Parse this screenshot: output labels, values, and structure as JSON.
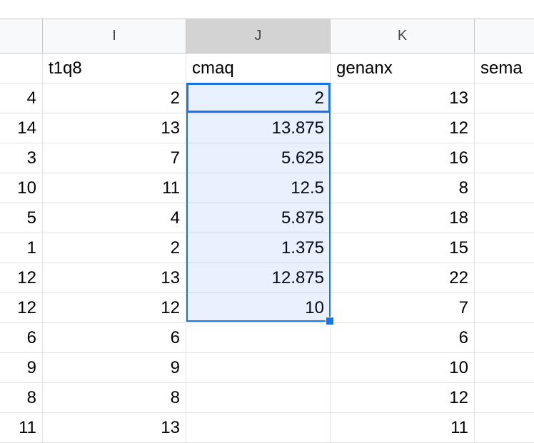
{
  "columns": [
    {
      "letter": "I"
    },
    {
      "letter": "J",
      "selected": true
    },
    {
      "letter": "K"
    },
    {
      "letter": ""
    }
  ],
  "header_labels": [
    "",
    "t1q8",
    "cmaq",
    "genanx",
    "sema"
  ],
  "rows": [
    [
      "4",
      "2",
      "2",
      "13",
      ""
    ],
    [
      "14",
      "13",
      "13.875",
      "12",
      ""
    ],
    [
      "3",
      "7",
      "5.625",
      "16",
      ""
    ],
    [
      "10",
      "11",
      "12.5",
      "8",
      ""
    ],
    [
      "5",
      "4",
      "5.875",
      "18",
      ""
    ],
    [
      "1",
      "2",
      "1.375",
      "15",
      ""
    ],
    [
      "12",
      "13",
      "12.875",
      "22",
      ""
    ],
    [
      "12",
      "12",
      "10",
      "7",
      ""
    ],
    [
      "6",
      "6",
      "",
      "6",
      ""
    ],
    [
      "9",
      "9",
      "",
      "10",
      ""
    ],
    [
      "8",
      "8",
      "",
      "12",
      ""
    ],
    [
      "11",
      "13",
      "",
      "11",
      ""
    ]
  ],
  "selection": {
    "column": "J",
    "active_cell_value": "2"
  },
  "colors": {
    "selection_border": "#1a73e8",
    "header_bg": "#f8f9fa",
    "selected_header_bg": "#d3d3d3"
  }
}
